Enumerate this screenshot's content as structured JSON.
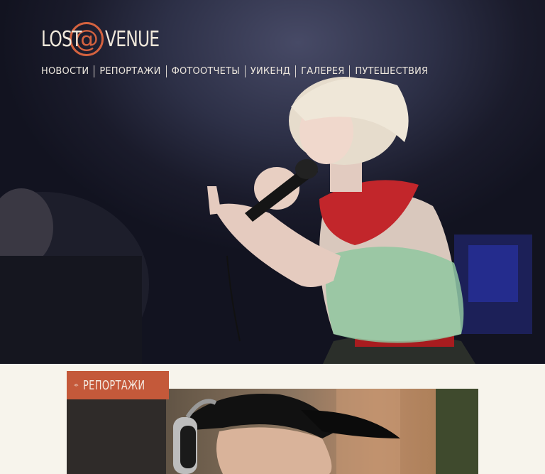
{
  "site": {
    "logo": {
      "left": "LOST",
      "at": "@",
      "right": "VENUE"
    },
    "accent_color": "#d4623f"
  },
  "nav": {
    "items": [
      {
        "label": "НОВОСТИ"
      },
      {
        "label": "РЕПОРТАЖИ"
      },
      {
        "label": "ФОТООТЧЕТЫ"
      },
      {
        "label": "УИКЕНД"
      },
      {
        "label": "ГАЛЕРЕЯ"
      },
      {
        "label": "ПУТЕШЕСТВИЯ"
      }
    ]
  },
  "section_badge": {
    "icon": "eye-icon",
    "label": "РЕПОРТАЖИ",
    "color": "#c4593a"
  }
}
